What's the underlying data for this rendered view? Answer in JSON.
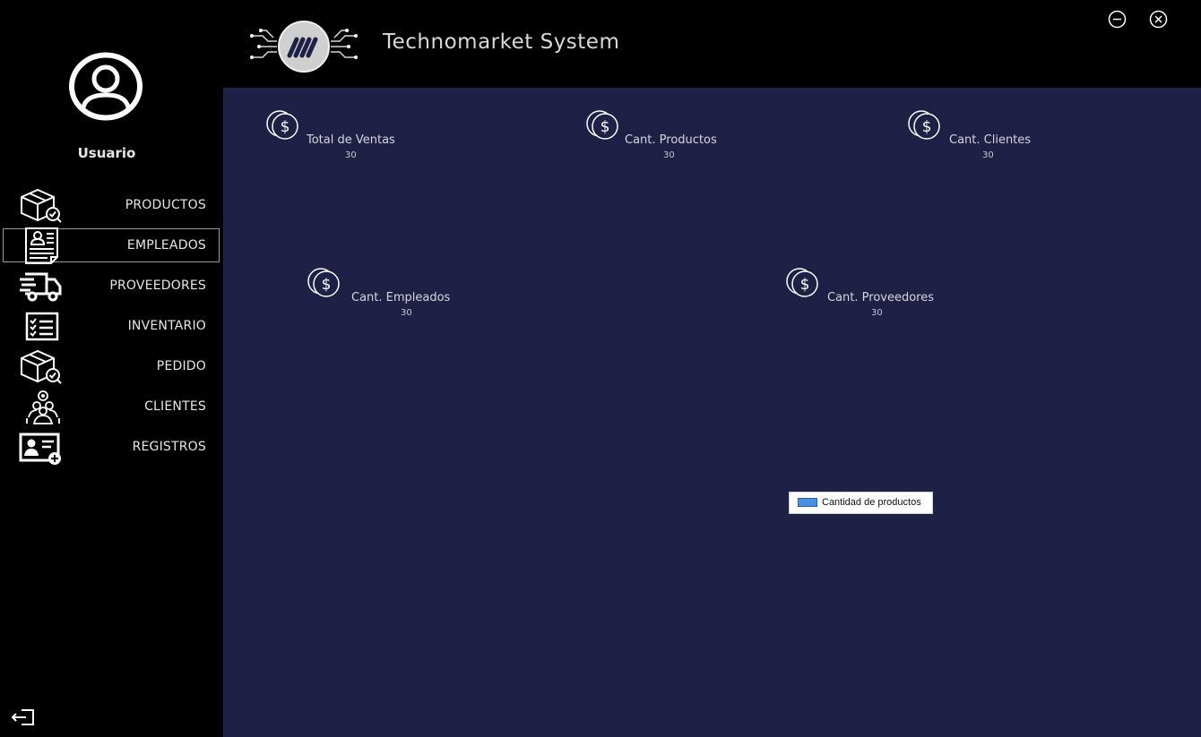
{
  "app": {
    "title": "Technomarket System"
  },
  "user": {
    "name": "Usuario"
  },
  "sidebar": {
    "items": [
      {
        "label": "PRODUCTOS",
        "icon": "box-search-icon",
        "active": false
      },
      {
        "label": "EMPLEADOS",
        "icon": "employee-document-icon",
        "active": true
      },
      {
        "label": "PROVEEDORES",
        "icon": "delivery-truck-icon",
        "active": false
      },
      {
        "label": "INVENTARIO",
        "icon": "checklist-icon",
        "active": false
      },
      {
        "label": "PEDIDO",
        "icon": "box-search-icon",
        "active": false
      },
      {
        "label": "CLIENTES",
        "icon": "customers-group-icon",
        "active": false
      },
      {
        "label": "REGISTROS",
        "icon": "add-user-card-icon",
        "active": false
      }
    ],
    "logout_icon": "logout-icon"
  },
  "window": {
    "minimize_icon": "minimize-icon",
    "close_icon": "close-icon"
  },
  "dashboard": {
    "stats": [
      {
        "title": "Total de Ventas",
        "value": "30",
        "icon": "coins-dollar-icon"
      },
      {
        "title": "Cant. Productos",
        "value": "30",
        "icon": "coins-dollar-icon"
      },
      {
        "title": "Cant. Clientes",
        "value": "30",
        "icon": "coins-dollar-icon"
      },
      {
        "title": "Cant. Empleados",
        "value": "30",
        "icon": "coins-dollar-icon"
      },
      {
        "title": "Cant. Proveedores",
        "value": "30",
        "icon": "coins-dollar-icon"
      }
    ],
    "chart_legend": {
      "label": "Cantidad de productos",
      "color": "#4a8fe0"
    }
  },
  "colors": {
    "sidebar_bg": "#000000",
    "content_bg": "#1f2045",
    "text": "#e6e6e6"
  }
}
